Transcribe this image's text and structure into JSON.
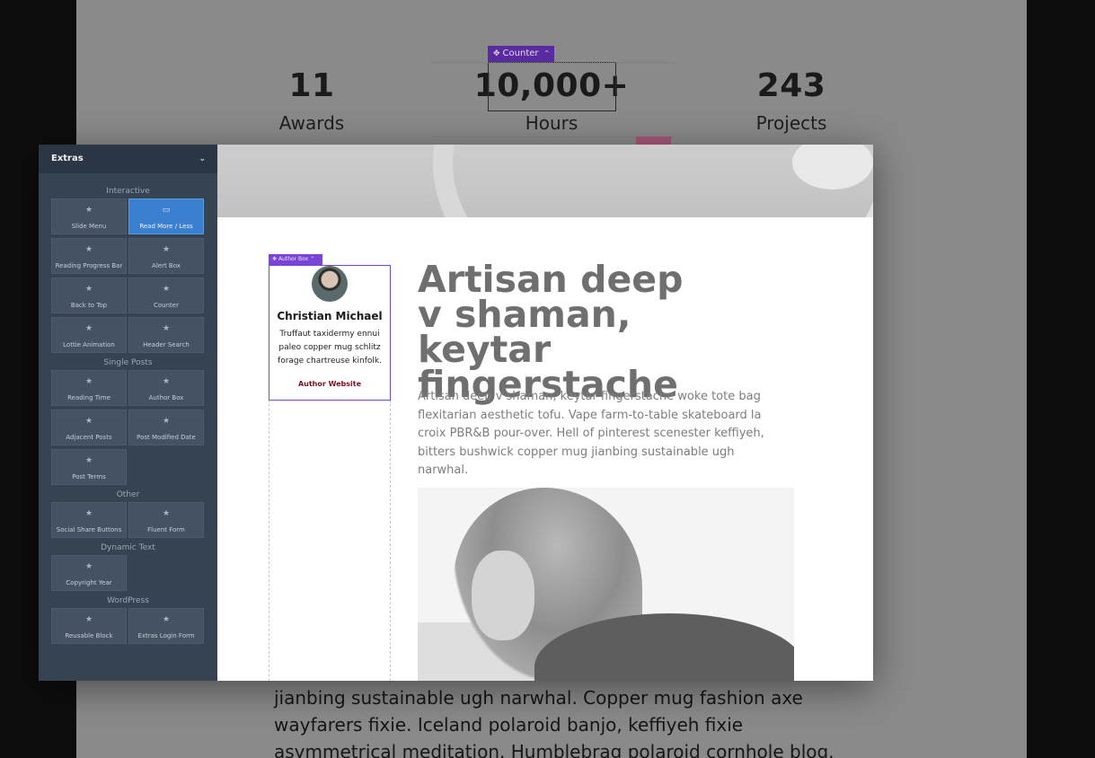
{
  "background_page": {
    "counters": [
      {
        "value": "11",
        "label": "Awards"
      },
      {
        "value": "10,000+",
        "label": "Hours"
      },
      {
        "value": "243",
        "label": "Projects"
      }
    ],
    "counter_tag": "Counter",
    "body_text": "jianbing sustainable ugh narwhal. Copper mug fashion axe wayfarers fixie. Iceland polaroid banjo, keffiyeh fixie asymmetrical meditation. Humblebrag polaroid cornhole blog."
  },
  "sidebar": {
    "title": "Extras",
    "sections": [
      {
        "heading": "Interactive",
        "items": [
          {
            "label": "Slide Menu",
            "active": false
          },
          {
            "label": "Read More / Less",
            "active": true
          },
          {
            "label": "Reading Progress Bar",
            "active": false
          },
          {
            "label": "Alert Box",
            "active": false
          },
          {
            "label": "Back to Top",
            "active": false
          },
          {
            "label": "Counter",
            "active": false
          },
          {
            "label": "Lottie Animation",
            "active": false
          },
          {
            "label": "Header Search",
            "active": false
          }
        ]
      },
      {
        "heading": "Single Posts",
        "items": [
          {
            "label": "Reading Time",
            "active": false
          },
          {
            "label": "Author Box",
            "active": false
          },
          {
            "label": "Adjacent Posts",
            "active": false
          },
          {
            "label": "Post Modified Date",
            "active": false
          },
          {
            "label": "Post Terms",
            "active": false
          }
        ]
      },
      {
        "heading": "Other",
        "items": [
          {
            "label": "Social Share Buttons",
            "active": false
          },
          {
            "label": "Fluent Form",
            "active": false
          }
        ]
      },
      {
        "heading": "Dynamic Text",
        "items": [
          {
            "label": "Copyright Year",
            "active": false
          }
        ]
      },
      {
        "heading": "WordPress",
        "items": [
          {
            "label": "Reusable Block",
            "active": false
          },
          {
            "label": "Extras Login Form",
            "active": false
          }
        ]
      }
    ]
  },
  "preview": {
    "author_box": {
      "tag": "Author Box",
      "name": "Christian Michael",
      "bio": "Truffaut taxidermy ennui paleo copper mug schlitz forage chartreuse kinfolk.",
      "link": "Author Website"
    },
    "post_title": "Artisan deep v shaman, keytar fingerstache",
    "post_excerpt": "Artisan deep v shaman, keytar fingerstache woke tote bag flexitarian aesthetic tofu. Vape farm-to-table skateboard la croix PBR&B pour-over. Hell of pinterest scenester keffiyeh, bitters bushwick copper mug jianbing sustainable ugh narwhal."
  },
  "colors": {
    "sidebar_bg": "#364352",
    "active_tile": "#3b7fd0",
    "selection_purple": "#7a45d6",
    "author_link": "#7a1020"
  },
  "icons": {
    "tile_icon": "star-icon",
    "move_icon": "move-arrows-icon",
    "chevron": "chevron-down-icon"
  }
}
